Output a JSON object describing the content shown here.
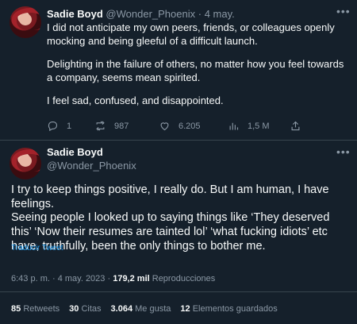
{
  "tweet1": {
    "name": "Sadie Boyd",
    "handle": "@Wonder_Phoenix",
    "separator": "·",
    "date": "4 may.",
    "paragraphs": [
      "I did not anticipate my own peers, friends, or colleagues openly mocking and being gleeful of a difficult launch.",
      "Delighting in the failure of others, no matter how you feel towards a company, seems mean spirited.",
      "I feel sad, confused, and disappointed."
    ],
    "replies": "1",
    "retweets": "987",
    "likes": "6.205",
    "views": "1,5 M"
  },
  "tweet2": {
    "name": "Sadie Boyd",
    "handle": "@Wonder_Phoenix",
    "paragraphs": [
      "I try to keep things positive, I really do. But I am human, I have feelings.",
      "Seeing people I looked up to saying things like ‘They deserved this’ ‘Now their resumes are tainted lol’ ‘what fucking idiots’ etc have, truthfully, been the only things to bother me."
    ],
    "translate_label": "Traducir Tweet",
    "timestamp": "6:43 p. m. · 4 may. 2023 ·",
    "views_count": "179,2 mil",
    "views_label": "Reproducciones",
    "stats": [
      {
        "count": "85",
        "label": "Retweets"
      },
      {
        "count": "30",
        "label": "Citas"
      },
      {
        "count": "3.064",
        "label": "Me gusta"
      },
      {
        "count": "12",
        "label": "Elementos guardados"
      }
    ]
  },
  "colors": {
    "background": "#15202b",
    "text": "#f7f9f9",
    "secondary": "#8b98a5",
    "link": "#1d9bf0",
    "divider": "#38444d"
  }
}
